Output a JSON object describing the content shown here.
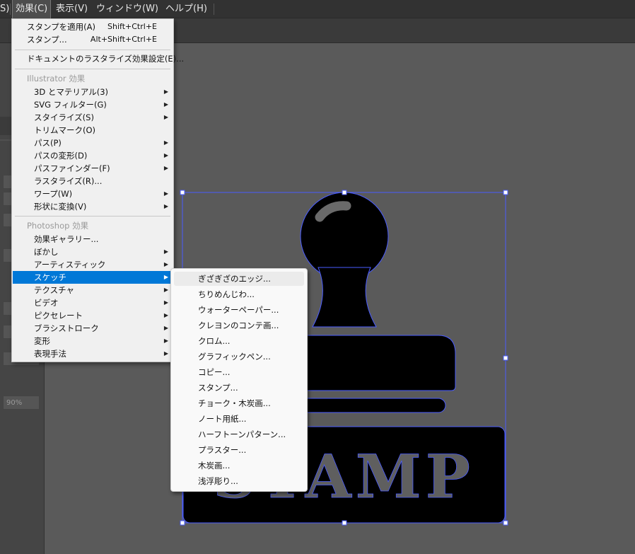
{
  "menubar": {
    "items": [
      {
        "label": "S)",
        "active": false
      },
      {
        "label": "効果(C)",
        "active": true
      },
      {
        "label": "表示(V)",
        "active": false
      },
      {
        "label": "ウィンドウ(W)",
        "active": false
      },
      {
        "label": "ヘルプ(H)",
        "active": false
      }
    ]
  },
  "effects_menu": {
    "apply_stamp": {
      "label": "スタンプを適用(A)",
      "shortcut": "Shift+Ctrl+E"
    },
    "stamp": {
      "label": "スタンプ...",
      "shortcut": "Alt+Shift+Ctrl+E"
    },
    "rasterize_settings": {
      "label": "ドキュメントのラスタライズ効果設定(E)..."
    },
    "illustrator_header": "Illustrator 効果",
    "illustrator_items": [
      "3D とマテリアル(3)",
      "SVG フィルター(G)",
      "スタイライズ(S)",
      "トリムマーク(O)",
      "パス(P)",
      "パスの変形(D)",
      "パスファインダー(F)",
      "ラスタライズ(R)...",
      "ワープ(W)",
      "形状に変換(V)"
    ],
    "photoshop_header": "Photoshop 効果",
    "photoshop_items": [
      "効果ギャラリー...",
      "ぼかし",
      "アーティスティック",
      "スケッチ",
      "テクスチャ",
      "ビデオ",
      "ピクセレート",
      "ブラシストローク",
      "変形",
      "表現手法"
    ],
    "selected_item": "スケッチ"
  },
  "sketch_submenu": {
    "items": [
      "ぎざぎざのエッジ...",
      "ちりめんじわ...",
      "ウォーターペーパー...",
      "クレヨンのコンテ画...",
      "クロム...",
      "グラフィックペン...",
      "コピー...",
      "スタンプ...",
      "チョーク・木炭画...",
      "ノート用紙...",
      "ハーフトーンパターン...",
      "プラスター...",
      "木炭画...",
      "浅浮彫り..."
    ],
    "hovered_item": "ぎざぎざのエッジ..."
  },
  "left_panel": {
    "zoom_value": "90%"
  },
  "artwork": {
    "text": "STAMP",
    "fill_color": "#000000",
    "text_color": "#5f5f5f",
    "selection_color": "#4a5cff"
  }
}
